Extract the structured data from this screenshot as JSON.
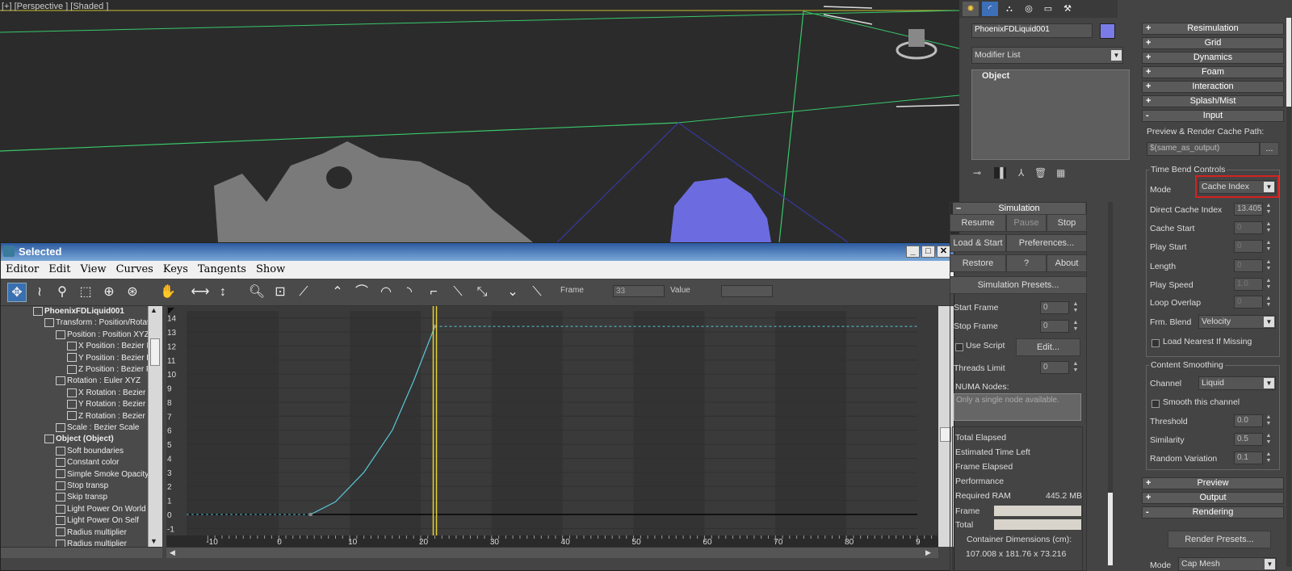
{
  "viewport": {
    "label": "[+] [Perspective ] [Shaded ]"
  },
  "curve_editor": {
    "title": "Selected",
    "menu": [
      "Editor",
      "Edit",
      "View",
      "Curves",
      "Keys",
      "Tangents",
      "Show"
    ],
    "frame_label": "Frame",
    "frame_value": "33",
    "value_label": "Value",
    "value_value": "",
    "tree": [
      {
        "label": "PhoenixFDLiquid001",
        "level": 0,
        "bold": true
      },
      {
        "label": "Transform : Position/Rotati",
        "level": 1
      },
      {
        "label": "Position : Position XYZ",
        "level": 2
      },
      {
        "label": "X Position : Bezier Fl",
        "level": 3
      },
      {
        "label": "Y Position : Bezier Fl",
        "level": 3
      },
      {
        "label": "Z Position : Bezier Fl",
        "level": 3
      },
      {
        "label": "Rotation : Euler XYZ",
        "level": 2
      },
      {
        "label": "X Rotation : Bezier F",
        "level": 3
      },
      {
        "label": "Y Rotation : Bezier F",
        "level": 3
      },
      {
        "label": "Z Rotation : Bezier F",
        "level": 3
      },
      {
        "label": "Scale : Bezier Scale",
        "level": 2
      },
      {
        "label": "Object (Object)",
        "level": 1,
        "bold": true
      },
      {
        "label": "Soft boundaries",
        "level": 2
      },
      {
        "label": "Constant color",
        "level": 2
      },
      {
        "label": "Simple Smoke Opacity",
        "level": 2
      },
      {
        "label": "Stop transp",
        "level": 2
      },
      {
        "label": "Skip transp",
        "level": 2
      },
      {
        "label": "Light Power On World",
        "level": 2
      },
      {
        "label": "Light Power On Self",
        "level": 2
      },
      {
        "label": "Radius multiplier",
        "level": 2
      },
      {
        "label": "Radius multiplier",
        "level": 2
      }
    ]
  },
  "chart_data": {
    "type": "line",
    "y_ticks": [
      "14",
      "13",
      "12",
      "11",
      "10",
      "9",
      "8",
      "7",
      "6",
      "5",
      "4",
      "3",
      "2",
      "1",
      "0",
      "-1"
    ],
    "x_ticks": [
      "-10",
      "0",
      "10",
      "20",
      "30",
      "40",
      "50",
      "60",
      "70",
      "80",
      "9"
    ],
    "ylim": [
      -1.5,
      14.5
    ],
    "xlim": [
      -13,
      90
    ],
    "series": [
      {
        "values": [
          [
            -13,
            0
          ],
          [
            4.5,
            0
          ],
          [
            8,
            0.9
          ],
          [
            12,
            3
          ],
          [
            16,
            6
          ],
          [
            19,
            9.5
          ],
          [
            22,
            13.4
          ],
          [
            90,
            13.4
          ]
        ]
      }
    ],
    "current_frame": 22
  },
  "right_panel": {
    "object_name": "PhoenixFDLiquid001",
    "modifier_list": "Modifier List",
    "stack_item": "Object",
    "accent": "#7b7be8",
    "simulation": {
      "title": "Simulation",
      "buttons": [
        "Resume",
        "Pause",
        "Stop",
        "Load & Start",
        "Preferences...",
        "Restore",
        "?",
        "About"
      ],
      "presets": "Simulation Presets...",
      "start_frame_label": "Start Frame",
      "start_frame": "0",
      "stop_frame_label": "Stop Frame",
      "stop_frame": "0",
      "use_script": "Use Script",
      "edit": "Edit...",
      "threads_label": "Threads Limit",
      "threads": "0",
      "numa_label": "NUMA Nodes:",
      "numa_text": "Only a single node available.",
      "total_elapsed": "Total Elapsed",
      "est_time": "Estimated Time Left",
      "frame_elapsed": "Frame Elapsed",
      "performance": "Performance",
      "req_ram_label": "Required RAM",
      "req_ram": "445.2 MB",
      "frame_label": "Frame",
      "total_label": "Total",
      "container_label": "Container Dimensions (cm):",
      "container": "107.008 x 181.76 x 73.216"
    },
    "rollouts": [
      {
        "sign": "+",
        "label": "Resimulation"
      },
      {
        "sign": "+",
        "label": "Grid"
      },
      {
        "sign": "+",
        "label": "Dynamics"
      },
      {
        "sign": "+",
        "label": "Foam"
      },
      {
        "sign": "+",
        "label": "Interaction"
      },
      {
        "sign": "+",
        "label": "Splash/Mist"
      },
      {
        "sign": "-",
        "label": "Input"
      }
    ],
    "input": {
      "cache_path_label": "Preview & Render Cache Path:",
      "cache_path": "$(same_as_output)",
      "browse": "...",
      "time_bend": "Time Bend Controls",
      "mode_label": "Mode",
      "mode": "Cache Index",
      "direct_label": "Direct Cache Index",
      "direct": "13.405",
      "cache_start_label": "Cache Start",
      "cache_start": "0",
      "play_start_label": "Play Start",
      "play_start": "0",
      "length_label": "Length",
      "length": "0",
      "play_speed_label": "Play Speed",
      "play_speed": "1.0",
      "loop_label": "Loop Overlap",
      "loop": "0",
      "frm_blend_label": "Frm. Blend",
      "frm_blend": "Velocity",
      "load_nearest": "Load Nearest If Missing",
      "content_smoothing": "Content Smoothing",
      "channel_label": "Channel",
      "channel": "Liquid",
      "smooth_channel": "Smooth this channel",
      "threshold_label": "Threshold",
      "threshold": "0.0",
      "similarity_label": "Similarity",
      "similarity": "0.5",
      "random_label": "Random Variation",
      "random": "0.1"
    },
    "bottom_rollouts": [
      {
        "sign": "+",
        "label": "Preview"
      },
      {
        "sign": "+",
        "label": "Output"
      },
      {
        "sign": "-",
        "label": "Rendering"
      }
    ],
    "render_presets": "Render Presets...",
    "render_mode_label": "Mode",
    "render_mode": "Cap Mesh"
  }
}
